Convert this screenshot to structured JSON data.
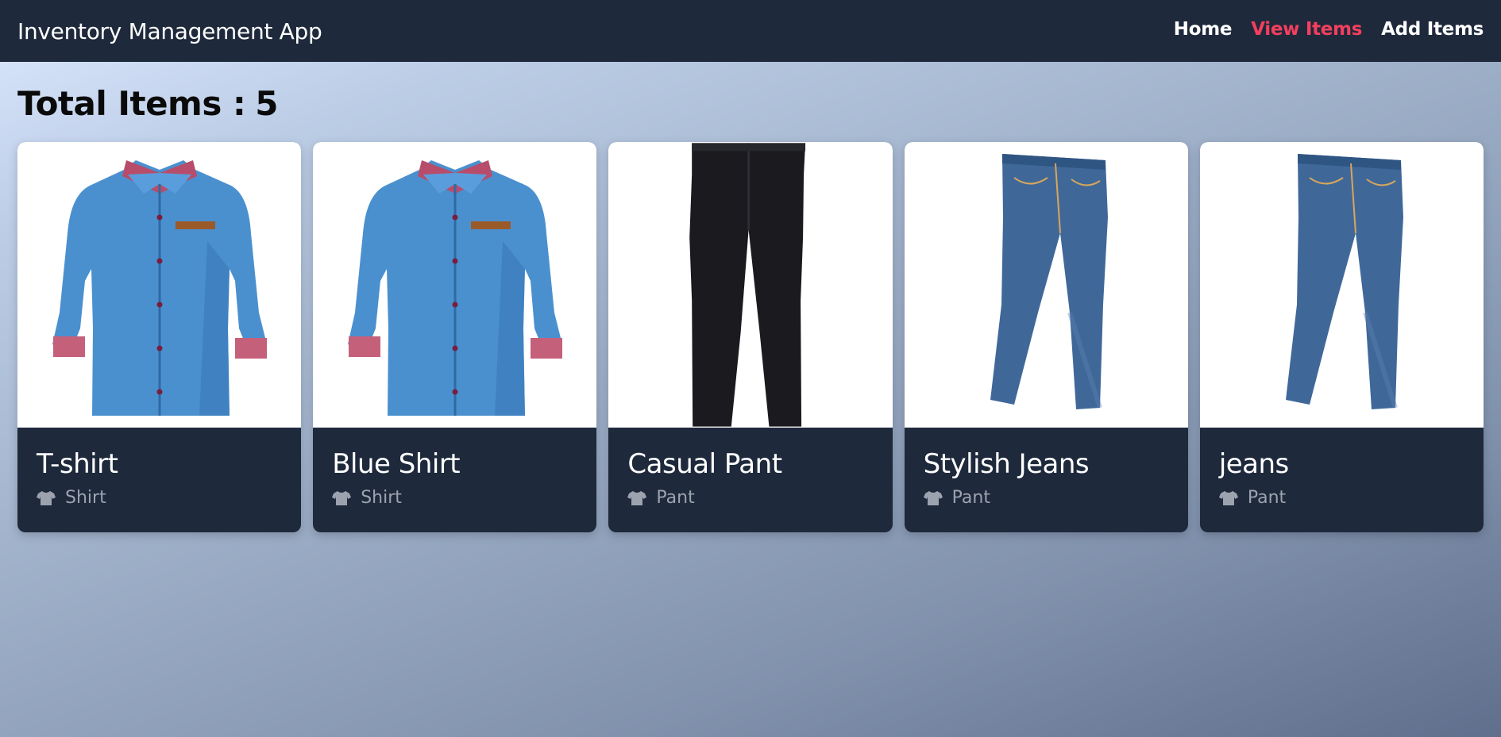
{
  "app": {
    "title": "Inventory Management App"
  },
  "nav": [
    {
      "label": "Home",
      "active": false
    },
    {
      "label": "View Items",
      "active": true
    },
    {
      "label": "Add Items",
      "active": false
    }
  ],
  "summary": {
    "label": "Total Items :",
    "count": "5"
  },
  "items": [
    {
      "name": "T-shirt",
      "category": "Shirt",
      "image": "denim-shirt",
      "category_icon": "tshirt-icon"
    },
    {
      "name": "Blue Shirt",
      "category": "Shirt",
      "image": "denim-shirt",
      "category_icon": "tshirt-icon"
    },
    {
      "name": "Casual Pant",
      "category": "Pant",
      "image": "black-pant",
      "category_icon": "tshirt-icon"
    },
    {
      "name": "Stylish Jeans",
      "category": "Pant",
      "image": "blue-jeans",
      "category_icon": "tshirt-icon"
    },
    {
      "name": "jeans",
      "category": "Pant",
      "image": "blue-jeans",
      "category_icon": "tshirt-icon"
    }
  ],
  "colors": {
    "navbar": "#1e293b",
    "active_link": "#f43f5e",
    "card_body": "#1e293b",
    "category_text": "#9ca3af"
  }
}
